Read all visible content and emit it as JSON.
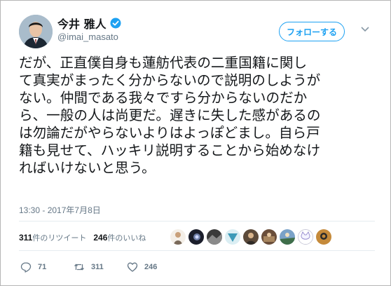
{
  "author": {
    "display_name": "今井 雅人",
    "handle": "@imai_masato",
    "verified": true
  },
  "follow_button_label": "フォローする",
  "tweet_text": "だが、正直僕自身も蓮舫代表の二重国籍に関し\nて真実がまったく分からないので説明のしようが\nない。仲間である我々ですら分からないのだか\nら、一般の人は尚更だ。遅きに失した感があるの\nは勿論だがやらないよりはよっぽどまし。自ら戸\n籍も見せて、ハッキリ説明することから始めなけ\nればいけないと思う。",
  "timestamp": "13:30 - 2017年7月8日",
  "stats": {
    "retweets_count": "311",
    "retweets_label": "件のリツイート",
    "likes_count": "246",
    "likes_label": "件のいいね"
  },
  "actions": {
    "reply_count": "71",
    "retweet_count": "311",
    "like_count": "246"
  },
  "colors": {
    "accent": "#1da1f2",
    "secondary_text": "#657786",
    "verified_badge": "#1da1f2"
  }
}
